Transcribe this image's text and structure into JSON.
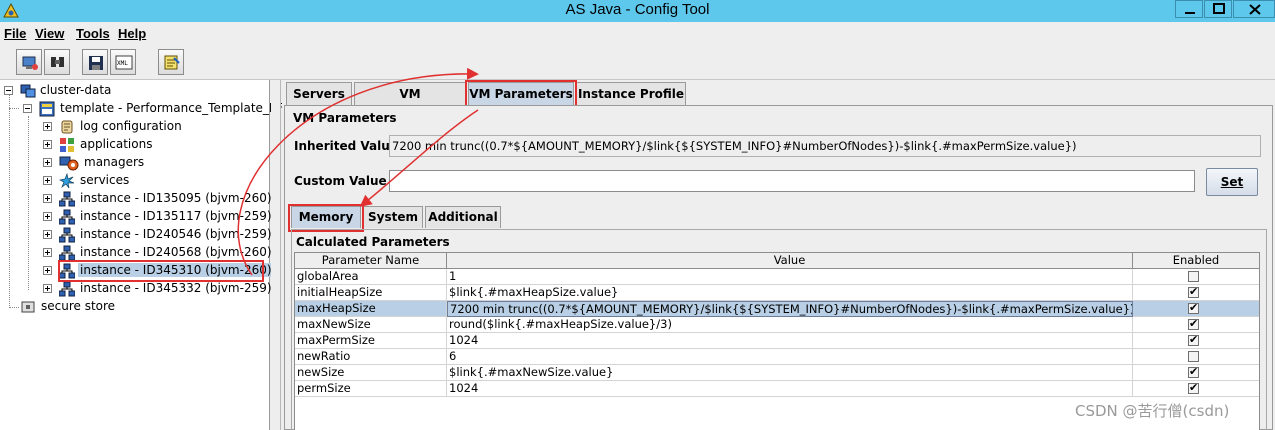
{
  "window": {
    "title": "AS Java - Config Tool"
  },
  "menu": [
    "File",
    "View",
    "Tools",
    "Help"
  ],
  "toolbar": {
    "icons": [
      "connect-icon",
      "find-icon",
      "save-icon",
      "xml-export-icon",
      "expert-mode-icon"
    ]
  },
  "tree": {
    "root": "cluster-data",
    "template": "template - Performance_Template_BF",
    "template_children": [
      "log configuration",
      "applications",
      "managers",
      "services"
    ],
    "instances": [
      "instance - ID135095 (bjvm-260)",
      "instance - ID135117 (bjvm-259)",
      "instance - ID240546 (bjvm-259)",
      "instance - ID240568 (bjvm-260)",
      "instance - ID345310 (bjvm-260)",
      "instance - ID345332 (bjvm-259)"
    ],
    "secure_store": "secure store",
    "selected_instance": "instance - ID345310 (bjvm-260)"
  },
  "tabs": [
    "Servers",
    "VM Environment",
    "VM Parameters",
    "Instance Profile"
  ],
  "active_tab": "VM Parameters",
  "vm_params": {
    "section_title": "VM Parameters",
    "inherited_label": "Inherited Value",
    "inherited_value": "7200 min trunc((0.7*${AMOUNT_MEMORY}/$link{${SYSTEM_INFO}#NumberOfNodes})-$link{.#maxPermSize.value})",
    "custom_label": "Custom Value",
    "custom_value": "",
    "set_button": "Set"
  },
  "subtabs": [
    "Memory",
    "System",
    "Additional"
  ],
  "active_subtab": "Memory",
  "calculated": {
    "title": "Calculated Parameters",
    "columns": [
      "Parameter Name",
      "Value",
      "Enabled"
    ],
    "rows": [
      {
        "name": "globalArea",
        "value": "1",
        "enabled": false
      },
      {
        "name": "initialHeapSize",
        "value": "$link{.#maxHeapSize.value}",
        "enabled": true
      },
      {
        "name": "maxHeapSize",
        "value": "7200 min trunc((0.7*${AMOUNT_MEMORY}/$link{${SYSTEM_INFO}#NumberOfNodes})-$link{.#maxPermSize.value})",
        "enabled": true
      },
      {
        "name": "maxNewSize",
        "value": "round($link{.#maxHeapSize.value}/3)",
        "enabled": true
      },
      {
        "name": "maxPermSize",
        "value": "1024",
        "enabled": true
      },
      {
        "name": "newRatio",
        "value": "6",
        "enabled": false
      },
      {
        "name": "newSize",
        "value": "$link{.#maxNewSize.value}",
        "enabled": true
      },
      {
        "name": "permSize",
        "value": "1024",
        "enabled": true
      }
    ],
    "selected_row": "maxHeapSize"
  },
  "watermark": "CSDN @苦行僧(csdn)",
  "colors": {
    "titlebar": "#5ec8ec",
    "selection": "#b8cfe5",
    "annotation": "#e03030"
  }
}
